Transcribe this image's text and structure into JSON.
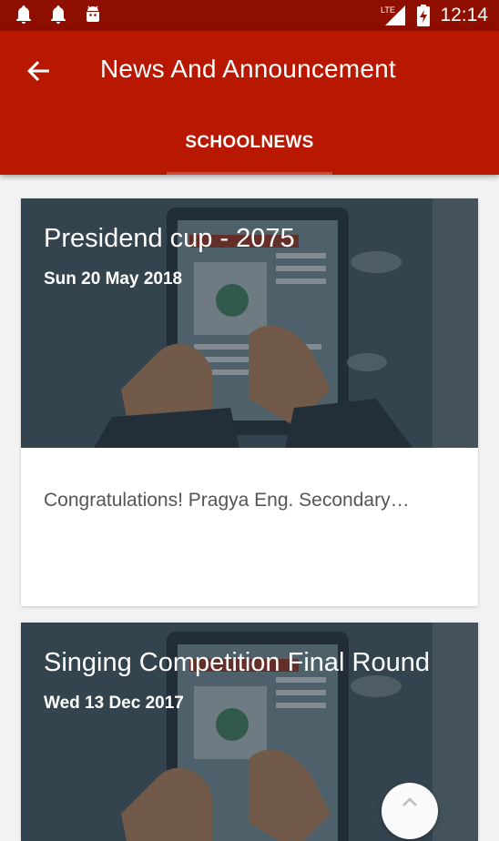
{
  "status_bar": {
    "time": "12:14",
    "network": "LTE",
    "icons": [
      "notification-bell-icon",
      "notification-bell-icon",
      "android-icon",
      "signal-icon",
      "battery-charging-icon"
    ]
  },
  "app_bar": {
    "title": "News And Announcement",
    "back_icon": "arrow-back-icon",
    "background_color": "#b81700"
  },
  "tabs": [
    {
      "label": "SCHOOLNEWS",
      "selected": true
    }
  ],
  "news": [
    {
      "title": "Presidend cup - 2075",
      "date": "Sun 20 May 2018",
      "description": "Congratulations! Pragya Eng. Secondary…"
    },
    {
      "title": "Singing Competition Final Round",
      "date": "Wed 13 Dec 2017",
      "description": ""
    }
  ],
  "fab": {
    "icon": "chevron-up-icon"
  }
}
